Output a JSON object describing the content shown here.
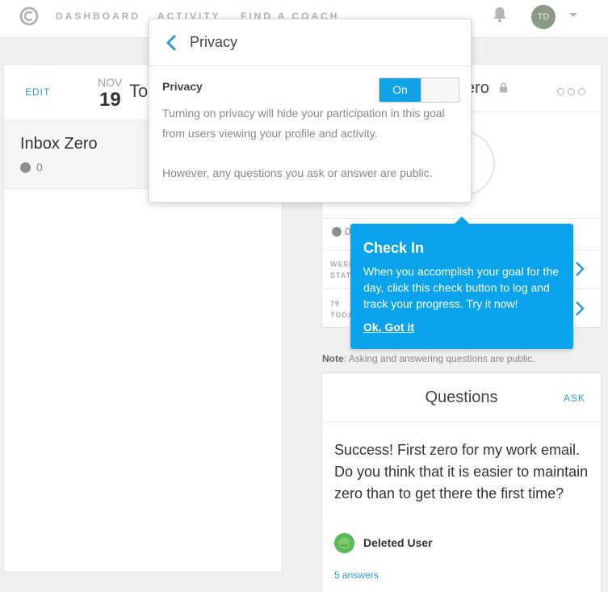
{
  "nav": {
    "links": [
      "DASHBOARD",
      "ACTIVITY",
      "FIND A COACH"
    ],
    "avatar_initials": "TD"
  },
  "left": {
    "edit": "EDIT",
    "month": "NOV",
    "day": "19",
    "title_rest": "To",
    "goal": {
      "title": "Inbox Zero",
      "count": "0"
    }
  },
  "right_card": {
    "title_partial": "ero",
    "count": "0",
    "stat1": "WEEK\nSTATS",
    "stat2": "79\nTODA"
  },
  "note": {
    "label": "Note",
    "text": ": Asking and answering questions are public."
  },
  "questions": {
    "title": "Questions",
    "ask": "ASK",
    "text": "Success! First zero for my work email. Do you think that it is easier to maintain zero than to get there the first time?",
    "user": "Deleted User",
    "answers": "5 answers"
  },
  "privacy_popup": {
    "title": "Privacy",
    "label": "Privacy",
    "toggle_on": "On",
    "desc": "Turning on privacy will hide your participation in this goal from users viewing your profile and activity.",
    "desc2": "However, any questions you ask or answer are public."
  },
  "checkin_tip": {
    "title": "Check In",
    "body": "When you accomplish your goal for the day, click this check button to log and track your progress. Try it now!",
    "ok": "Ok, Got it"
  },
  "colors": {
    "accent": "#0ba3ec",
    "link": "#2a9bd6"
  }
}
